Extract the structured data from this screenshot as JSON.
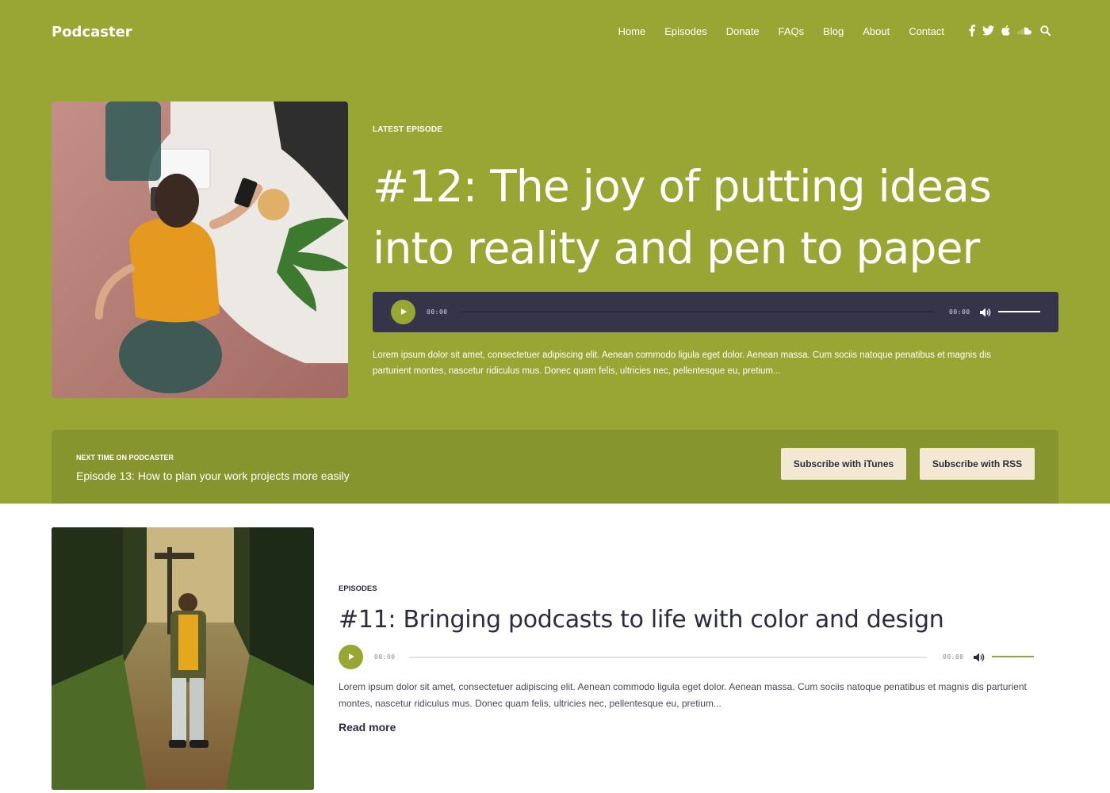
{
  "site": {
    "logo": "Podcaster"
  },
  "nav": {
    "items": [
      {
        "label": "Home"
      },
      {
        "label": "Episodes"
      },
      {
        "label": "Donate"
      },
      {
        "label": "FAQs"
      },
      {
        "label": "Blog"
      },
      {
        "label": "About"
      },
      {
        "label": "Contact"
      }
    ]
  },
  "social_icons": [
    "facebook-icon",
    "twitter-icon",
    "apple-icon",
    "soundcloud-icon",
    "search-icon"
  ],
  "latest": {
    "eyebrow": "LATEST EPISODE",
    "title_line1": "#12: The joy of putting ideas",
    "title_line2": "into reality and pen to paper",
    "player": {
      "current_time": "00:00",
      "duration": "00:00",
      "progress": 0,
      "volume": 1.0
    },
    "description_line1": "Lorem ipsum dolor sit amet, consectetuer adipiscing elit. Aenean commodo ligula eget dolor. Aenean massa. Cum sociis natoque penatibus et magnis dis",
    "description_line2": "parturient montes, nascetur ridiculus mus. Donec quam felis, ultricies nec, pellentesque eu, pretium..."
  },
  "next": {
    "label": "NEXT TIME ON PODCASTER",
    "title": "Episode 13: How to plan your work projects more easily",
    "subscribe_itunes": "Subscribe with iTunes",
    "subscribe_rss": "Subscribe with RSS"
  },
  "episode": {
    "eyebrow": "EPISODES",
    "title": "#11: Bringing podcasts to life with color and design",
    "player": {
      "current_time": "00:00",
      "duration": "00:00",
      "progress": 0,
      "volume": 1.0
    },
    "description_line1": "Lorem ipsum dolor sit amet, consectetuer adipiscing elit. Aenean commodo ligula eget dolor. Aenean massa. Cum sociis natoque penatibus et magnis dis parturient",
    "description_line2": "montes, nascetur ridiculus mus. Donec quam felis, ultricies nec, pellentesque eu, pretium...",
    "read_more": "Read more"
  },
  "colors": {
    "accent": "#98a733",
    "accent_dark": "#87952e",
    "player_dark": "#35344a",
    "button_bg": "#f3e8d3",
    "text_dark": "#2c2c3e"
  }
}
